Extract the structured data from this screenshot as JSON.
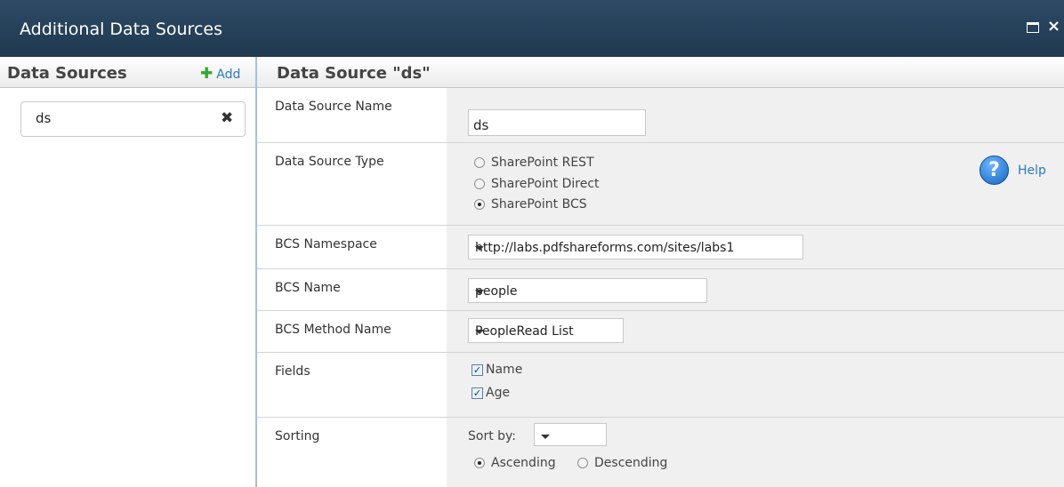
{
  "window": {
    "title": "Additional Data Sources",
    "maximize_icon": "maximize-icon",
    "close_glyph": "×"
  },
  "left": {
    "header": "Data Sources",
    "add_label": "Add",
    "items": [
      {
        "label": "ds",
        "remove_glyph": "✖"
      }
    ]
  },
  "right": {
    "header": "Data Source \"ds\"",
    "name": {
      "label": "Data Source Name",
      "value": "ds"
    },
    "type": {
      "label": "Data Source Type",
      "options": [
        "SharePoint REST",
        "SharePoint Direct",
        "SharePoint BCS"
      ],
      "selected": "SharePoint BCS",
      "help_label": "Help"
    },
    "namespace": {
      "label": "BCS Namespace",
      "value": "http://labs.pdfshareforms.com/sites/labs1"
    },
    "bcs_name": {
      "label": "BCS Name",
      "value": "people"
    },
    "method": {
      "label": "BCS Method Name",
      "value": "PeopleRead List"
    },
    "fields": {
      "label": "Fields",
      "items": [
        {
          "label": "Name",
          "checked": true
        },
        {
          "label": "Age",
          "checked": true
        }
      ]
    },
    "sorting": {
      "label": "Sorting",
      "sort_by_label": "Sort by:",
      "sort_by_value": "",
      "ascending_label": "Ascending",
      "descending_label": "Descending",
      "direction": "Ascending"
    }
  },
  "colors": {
    "titlebar": "#1f3950",
    "accent_link": "#2a7ac8",
    "add_plus": "#31a831",
    "divider": "#9fc3e0"
  }
}
